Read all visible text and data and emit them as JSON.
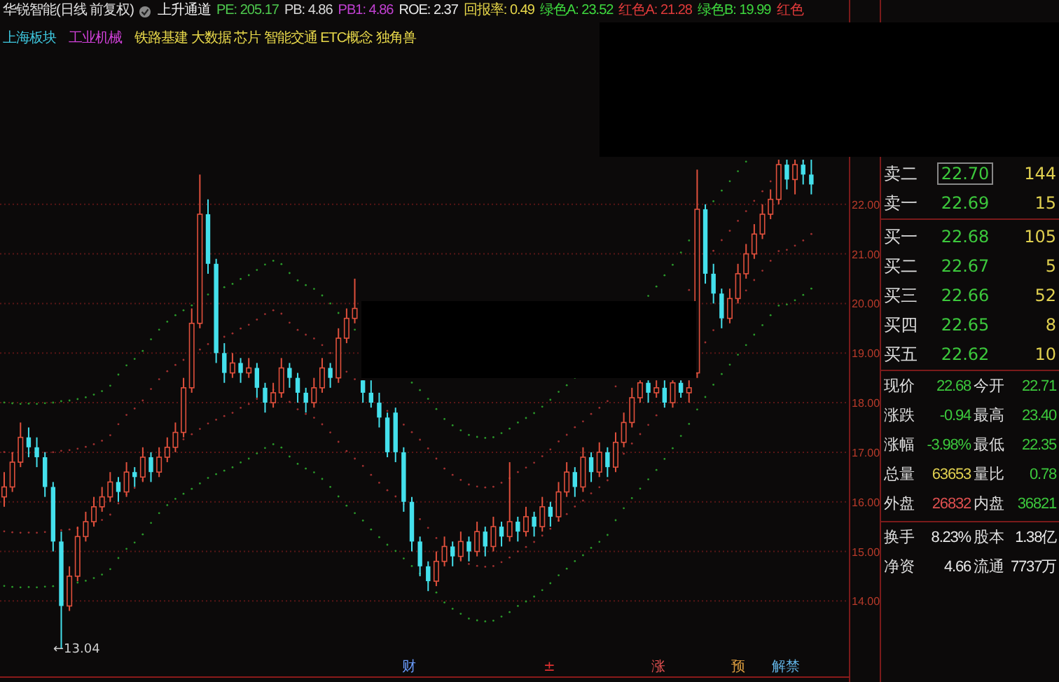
{
  "header": {
    "title": "华锐智能(日线 前复权)",
    "indicator": "上升通道",
    "stats": [
      {
        "text": "PE: 205.17",
        "color": "#4ec94e"
      },
      {
        "text": "PB: 4.86",
        "color": "#d8d8d8"
      },
      {
        "text": "PB1: 4.86",
        "color": "#c040d0"
      },
      {
        "text": "ROE: 2.37",
        "color": "#e8e8e8"
      },
      {
        "text": "回报率: 0.49",
        "color": "#e8d84a"
      },
      {
        "text": "绿色A: 23.52",
        "color": "#3ed83e"
      },
      {
        "text": "红色A: 21.28",
        "color": "#e03a3a"
      },
      {
        "text": "绿色B: 19.99",
        "color": "#3ed83e"
      },
      {
        "text": "红色",
        "color": "#e03a3a"
      }
    ]
  },
  "tags": [
    {
      "text": "上海板块",
      "color": "#3ec8e0"
    },
    {
      "text": "工业机械",
      "color": "#d040d8"
    },
    {
      "text": "铁路基建 大数据 芯片 智能交通 ETC概念 独角兽",
      "color": "#e8d84a"
    }
  ],
  "chart": {
    "chart_data": {
      "type": "candlestick",
      "ylim": [
        12.48,
        26.12
      ],
      "grid": true,
      "yticks": [
        {
          "value": 22,
          "label": "22.00"
        },
        {
          "value": 21,
          "label": "21.00"
        },
        {
          "value": 20,
          "label": "20.00"
        },
        {
          "value": 19,
          "label": "19.00"
        },
        {
          "value": 18,
          "label": "18.00"
        },
        {
          "value": 17,
          "label": "17.00"
        },
        {
          "value": 16,
          "label": "16.00"
        },
        {
          "value": 15,
          "label": "15.00"
        },
        {
          "value": 14,
          "label": "14.00"
        }
      ],
      "ohlc": [
        [
          16.1,
          16.6,
          15.9,
          16.3
        ],
        [
          16.3,
          17.0,
          16.2,
          16.8
        ],
        [
          16.8,
          17.6,
          16.7,
          17.3
        ],
        [
          17.3,
          17.5,
          16.9,
          17.1
        ],
        [
          17.1,
          17.3,
          16.7,
          16.9
        ],
        [
          16.9,
          17.0,
          16.1,
          16.3
        ],
        [
          16.3,
          16.4,
          15.0,
          15.2
        ],
        [
          15.2,
          15.4,
          13.04,
          13.9
        ],
        [
          13.9,
          14.7,
          13.8,
          14.5
        ],
        [
          14.5,
          15.5,
          14.4,
          15.3
        ],
        [
          15.3,
          15.8,
          15.2,
          15.6
        ],
        [
          15.6,
          16.1,
          15.5,
          15.9
        ],
        [
          15.9,
          16.3,
          15.8,
          16.1
        ],
        [
          16.1,
          16.6,
          16.0,
          16.4
        ],
        [
          16.4,
          16.5,
          16.0,
          16.2
        ],
        [
          16.2,
          16.8,
          16.1,
          16.6
        ],
        [
          16.6,
          16.7,
          16.3,
          16.5
        ],
        [
          16.5,
          17.1,
          16.4,
          16.9
        ],
        [
          16.9,
          17.0,
          16.4,
          16.6
        ],
        [
          16.6,
          17.1,
          16.5,
          16.9
        ],
        [
          16.9,
          17.3,
          16.8,
          17.1
        ],
        [
          17.1,
          17.6,
          17.0,
          17.4
        ],
        [
          17.4,
          18.5,
          17.3,
          18.3
        ],
        [
          18.3,
          19.9,
          18.2,
          19.6
        ],
        [
          19.6,
          22.6,
          19.5,
          21.8
        ],
        [
          21.8,
          22.1,
          20.6,
          20.8
        ],
        [
          20.8,
          20.9,
          18.8,
          19.0
        ],
        [
          19.0,
          19.2,
          18.4,
          18.6
        ],
        [
          18.6,
          19.0,
          18.5,
          18.8
        ],
        [
          18.8,
          18.9,
          18.4,
          18.6
        ],
        [
          18.6,
          18.9,
          18.5,
          18.7
        ],
        [
          18.7,
          18.8,
          18.1,
          18.3
        ],
        [
          18.3,
          18.4,
          17.8,
          18.0
        ],
        [
          18.0,
          18.4,
          17.9,
          18.2
        ],
        [
          18.2,
          18.9,
          18.1,
          18.7
        ],
        [
          18.7,
          18.8,
          18.3,
          18.5
        ],
        [
          18.5,
          18.6,
          18.0,
          18.2
        ],
        [
          18.2,
          18.3,
          17.8,
          18.0
        ],
        [
          18.0,
          18.5,
          17.9,
          18.3
        ],
        [
          18.3,
          18.9,
          18.2,
          18.7
        ],
        [
          18.7,
          18.8,
          18.3,
          18.5
        ],
        [
          18.5,
          19.5,
          18.4,
          19.3
        ],
        [
          19.3,
          19.9,
          19.2,
          19.7
        ],
        [
          19.7,
          20.5,
          19.6,
          19.9
        ],
        [
          18.45,
          18.45,
          18.0,
          18.2
        ],
        [
          18.2,
          18.45,
          17.9,
          18.0
        ],
        [
          18.0,
          18.2,
          17.5,
          17.7
        ],
        [
          17.7,
          17.8,
          16.9,
          17.0
        ],
        [
          17.8,
          17.9,
          16.8,
          17.0
        ],
        [
          17.0,
          17.1,
          15.8,
          16.0
        ],
        [
          16.0,
          16.1,
          15.0,
          15.2
        ],
        [
          15.2,
          15.3,
          14.5,
          14.7
        ],
        [
          14.7,
          14.8,
          14.2,
          14.4
        ],
        [
          14.4,
          15.0,
          14.3,
          14.8
        ],
        [
          14.8,
          15.3,
          14.7,
          15.1
        ],
        [
          15.1,
          15.2,
          14.7,
          14.9
        ],
        [
          14.9,
          15.4,
          14.8,
          15.2
        ],
        [
          15.2,
          15.3,
          14.8,
          15.0
        ],
        [
          15.0,
          15.6,
          14.9,
          15.4
        ],
        [
          15.4,
          15.5,
          14.9,
          15.1
        ],
        [
          15.1,
          15.7,
          15.0,
          15.5
        ],
        [
          15.5,
          15.6,
          15.1,
          15.3
        ],
        [
          15.3,
          16.8,
          15.2,
          15.6
        ],
        [
          15.6,
          15.7,
          15.2,
          15.4
        ],
        [
          15.4,
          15.9,
          15.3,
          15.7
        ],
        [
          15.7,
          15.8,
          15.3,
          15.5
        ],
        [
          15.5,
          16.1,
          15.4,
          15.9
        ],
        [
          15.9,
          16.0,
          15.5,
          15.7
        ],
        [
          15.7,
          16.4,
          15.6,
          16.2
        ],
        [
          16.2,
          16.8,
          16.1,
          16.6
        ],
        [
          16.6,
          16.7,
          16.1,
          16.3
        ],
        [
          16.3,
          17.1,
          16.2,
          16.9
        ],
        [
          16.9,
          17.0,
          16.4,
          16.6
        ],
        [
          16.6,
          17.2,
          16.5,
          17.0
        ],
        [
          17.0,
          17.1,
          16.5,
          16.7
        ],
        [
          16.7,
          17.4,
          16.6,
          17.2
        ],
        [
          17.2,
          17.8,
          17.1,
          17.6
        ],
        [
          17.6,
          18.3,
          17.5,
          18.1
        ],
        [
          18.1,
          18.45,
          18.0,
          18.4
        ],
        [
          18.4,
          18.45,
          18.0,
          18.2
        ],
        [
          18.2,
          18.45,
          18.1,
          18.3
        ],
        [
          18.3,
          18.45,
          17.9,
          18.0
        ],
        [
          18.0,
          18.45,
          17.9,
          18.4
        ],
        [
          18.4,
          18.45,
          18.1,
          18.2
        ],
        [
          18.2,
          18.45,
          18.0,
          18.3
        ],
        [
          18.6,
          22.7,
          18.5,
          21.9
        ],
        [
          21.9,
          22.0,
          20.4,
          20.6
        ],
        [
          20.6,
          20.8,
          20.0,
          20.2
        ],
        [
          20.2,
          20.3,
          19.5,
          19.7
        ],
        [
          19.7,
          20.3,
          19.6,
          20.1
        ],
        [
          20.1,
          20.8,
          20.0,
          20.6
        ],
        [
          20.6,
          21.2,
          20.5,
          21.0
        ],
        [
          21.0,
          21.6,
          20.9,
          21.4
        ],
        [
          21.4,
          22.0,
          21.3,
          21.8
        ],
        [
          21.8,
          22.3,
          21.7,
          22.1
        ],
        [
          22.1,
          22.9,
          22.0,
          22.8
        ],
        [
          22.8,
          22.9,
          22.3,
          22.5
        ],
        [
          22.5,
          22.9,
          22.2,
          22.8
        ],
        [
          22.8,
          22.9,
          22.4,
          22.6
        ],
        [
          22.6,
          22.9,
          22.2,
          22.4
        ]
      ]
    },
    "low_marker": "←13.04",
    "events": [
      {
        "text": "财",
        "color": "#6a9cff"
      },
      {
        "text": "±",
        "color": "#e03030"
      },
      {
        "text": "涨",
        "color": "#e05050"
      },
      {
        "text": "预",
        "color": "#e0a040"
      },
      {
        "text": "解禁",
        "color": "#60b0e0"
      }
    ]
  },
  "quote": {
    "asks": [
      {
        "label": "卖二",
        "price": "22.70",
        "volume": "144",
        "selected": true
      },
      {
        "label": "卖一",
        "price": "22.69",
        "volume": "15",
        "selected": false
      }
    ],
    "bids": [
      {
        "label": "买一",
        "price": "22.68",
        "volume": "105",
        "selected": false
      },
      {
        "label": "买二",
        "price": "22.67",
        "volume": "5",
        "selected": false
      },
      {
        "label": "买三",
        "price": "22.66",
        "volume": "52",
        "selected": false
      },
      {
        "label": "买四",
        "price": "22.65",
        "volume": "8",
        "selected": false
      },
      {
        "label": "买五",
        "price": "22.62",
        "volume": "10",
        "selected": false
      }
    ],
    "stats": [
      {
        "cells": [
          {
            "label": "现价",
            "value": "22.68",
            "color": "#3cc83c"
          },
          {
            "label": "今开",
            "value": "22.71",
            "color": "#3cc83c"
          }
        ]
      },
      {
        "cells": [
          {
            "label": "涨跌",
            "value": "-0.94",
            "color": "#3cc83c"
          },
          {
            "label": "最高",
            "value": "23.40",
            "color": "#3cc83c"
          }
        ]
      },
      {
        "cells": [
          {
            "label": "涨幅",
            "value": "-3.98%",
            "color": "#3cc83c"
          },
          {
            "label": "最低",
            "value": "22.35",
            "color": "#3cc83c"
          }
        ]
      },
      {
        "cells": [
          {
            "label": "总量",
            "value": "63653",
            "color": "#e0d050"
          },
          {
            "label": "量比",
            "value": "0.78",
            "color": "#3cc83c"
          }
        ]
      },
      {
        "cells": [
          {
            "label": "外盘",
            "value": "26832",
            "color": "#e05050"
          },
          {
            "label": "内盘",
            "value": "36821",
            "color": "#3cc83c"
          }
        ]
      }
    ],
    "capital": [
      {
        "label": "换手",
        "value": "8.23%",
        "label_2": "股本",
        "value_2": "1.38亿"
      },
      {
        "label": "净资",
        "value": "4.66",
        "label_2": "流通",
        "value_2": "7737万"
      }
    ]
  }
}
